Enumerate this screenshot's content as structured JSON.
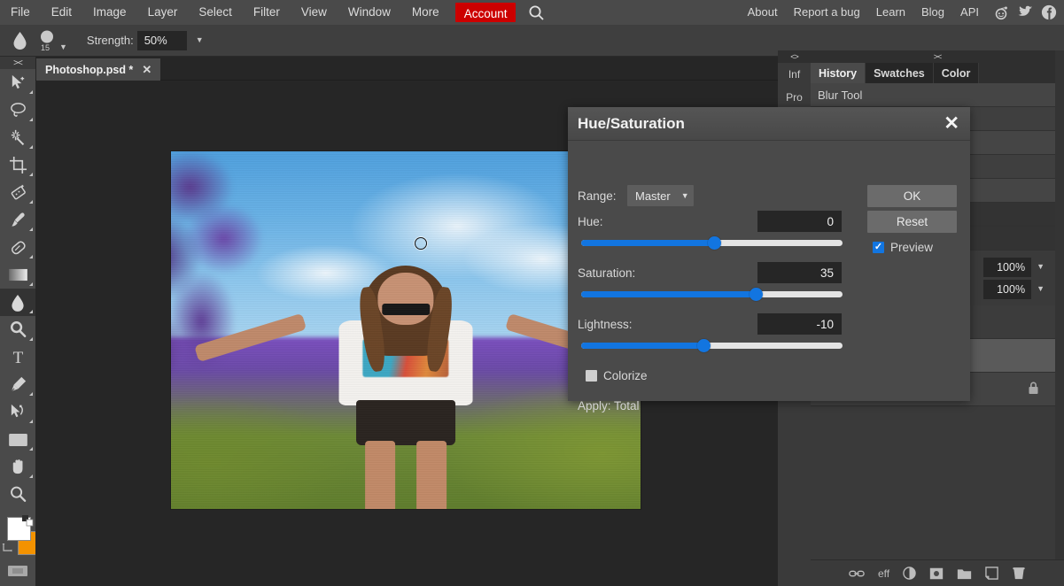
{
  "menubar": {
    "left_items": [
      "File",
      "Edit",
      "Image",
      "Layer",
      "Select",
      "Filter",
      "View",
      "Window",
      "More"
    ],
    "account_label": "Account",
    "search_icon": "search-icon",
    "right_items": [
      "About",
      "Report a bug",
      "Learn",
      "Blog",
      "API"
    ],
    "social_icons": [
      "reddit-icon",
      "twitter-icon",
      "facebook-icon"
    ],
    "account_bg": "#cc0000"
  },
  "options_bar": {
    "tool_icon": "blur-tool-icon",
    "brush_size": "15",
    "strength_label": "Strength:",
    "strength_value": "50%"
  },
  "toolbar": {
    "grip": "><",
    "tools": [
      {
        "name": "move-tool"
      },
      {
        "name": "lasso-tool"
      },
      {
        "name": "magic-wand-tool"
      },
      {
        "name": "crop-tool"
      },
      {
        "name": "patch-tool"
      },
      {
        "name": "brush-tool"
      },
      {
        "name": "eraser-tool"
      },
      {
        "name": "gradient-tool"
      },
      {
        "name": "blur-tool"
      },
      {
        "name": "dodge-tool"
      },
      {
        "name": "type-tool"
      },
      {
        "name": "pen-tool"
      },
      {
        "name": "path-selection-tool"
      },
      {
        "name": "shape-tool"
      },
      {
        "name": "hand-tool"
      },
      {
        "name": "zoom-tool"
      }
    ],
    "selected_tool": "blur-tool",
    "foreground_color": "#ffffff",
    "background_color": "#f39200"
  },
  "document": {
    "tab_title": "Photoshop.psd *",
    "close_label": "✕"
  },
  "right_panel": {
    "vertical_grip": "<>",
    "vertical_tabs": [
      "Inf",
      "Pro"
    ],
    "panel_grip": "><",
    "tabs": [
      {
        "label": "History",
        "active": true
      },
      {
        "label": "Swatches",
        "active": false
      },
      {
        "label": "Color",
        "active": false
      }
    ],
    "history_items": [
      "Blur Tool",
      "",
      "",
      "",
      "",
      "",
      ""
    ],
    "opacity_value": "100%",
    "fill_value": "100%",
    "lock_icon": "lock-icon",
    "bottom_icons": [
      "link-icon",
      "effects-icon",
      "adjustment-icon",
      "mask-icon",
      "folder-icon",
      "new-layer-icon",
      "delete-icon"
    ],
    "effects_label": "eff"
  },
  "dialog": {
    "title": "Hue/Saturation",
    "close_label": "✕",
    "range_label": "Range:",
    "range_value": "Master",
    "hue_label": "Hue:",
    "hue_value": "0",
    "hue_percent": 51,
    "saturation_label": "Saturation:",
    "saturation_value": "35",
    "saturation_percent": 67,
    "lightness_label": "Lightness:",
    "lightness_value": "-10",
    "lightness_percent": 47,
    "ok_label": "OK",
    "reset_label": "Reset",
    "preview_label": "Preview",
    "preview_checked": true,
    "colorize_label": "Colorize",
    "colorize_checked": false,
    "apply_label": "Apply: Total",
    "accent_color": "#1275e0"
  }
}
